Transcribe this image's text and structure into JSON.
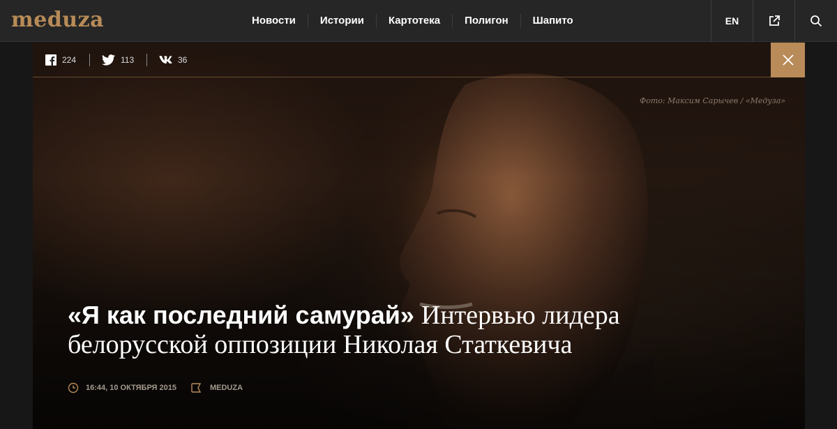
{
  "header": {
    "logo": "meduza",
    "nav": [
      "Новости",
      "Истории",
      "Картотека",
      "Полигон",
      "Шапито"
    ],
    "lang": "EN",
    "icons": [
      "external-link-icon",
      "search-icon"
    ]
  },
  "share": {
    "facebook": "224",
    "twitter": "113",
    "vk": "36"
  },
  "photo_credit": "Фото: Максим Сарычев / «Медуза»",
  "article": {
    "title_bold": "«Я как последний самурай»",
    "title_rest": "Интервью лидера белорусской оппозиции Николая Статкевича",
    "date": "16:44, 10 октября 2015",
    "source": "MEDUZA"
  },
  "colors": {
    "accent": "#b88b58",
    "header_bg": "#262626",
    "page_bg": "#171717"
  }
}
